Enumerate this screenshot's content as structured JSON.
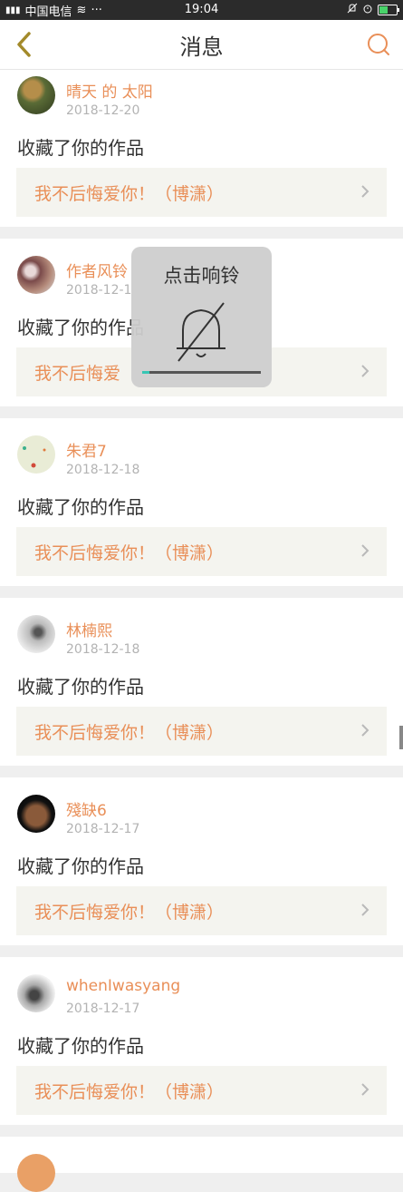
{
  "status_bar": {
    "carrier": "中国电信",
    "time": "19:04",
    "dots": "···"
  },
  "header": {
    "title": "消息",
    "back_icon": "back-chevron-icon",
    "search_icon": "search-icon"
  },
  "colors": {
    "accent": "#e98f58",
    "card_bg": "#ffffff",
    "work_bg": "#f4f4ef",
    "page_bg": "#efefef"
  },
  "messages": [
    {
      "name": "晴天 的 太阳",
      "date": "2018-12-20",
      "action": "收藏了你的作品",
      "work": "我不后悔爱你！（博潇）"
    },
    {
      "name": "作者风铃",
      "date": "2018-12-1",
      "action": "收藏了你的作品",
      "work": "我不后悔爱"
    },
    {
      "name": "朱君7",
      "date": "2018-12-18",
      "action": "收藏了你的作品",
      "work": "我不后悔爱你！（博潇）"
    },
    {
      "name": "林楠熙",
      "date": "2018-12-18",
      "action": "收藏了你的作品",
      "work": "我不后悔爱你！（博潇）"
    },
    {
      "name": "殘缺6",
      "date": "2018-12-17",
      "action": "收藏了你的作品",
      "work": "我不后悔爱你！（博潇）"
    },
    {
      "name": "whenIwasyang",
      "date": "2018-12-17",
      "action": "收藏了你的作品",
      "work": "我不后悔爱你！（博潇）"
    }
  ],
  "toast": {
    "text": "点击响铃",
    "icon": "bell-muted-icon",
    "progress": 0.06
  }
}
